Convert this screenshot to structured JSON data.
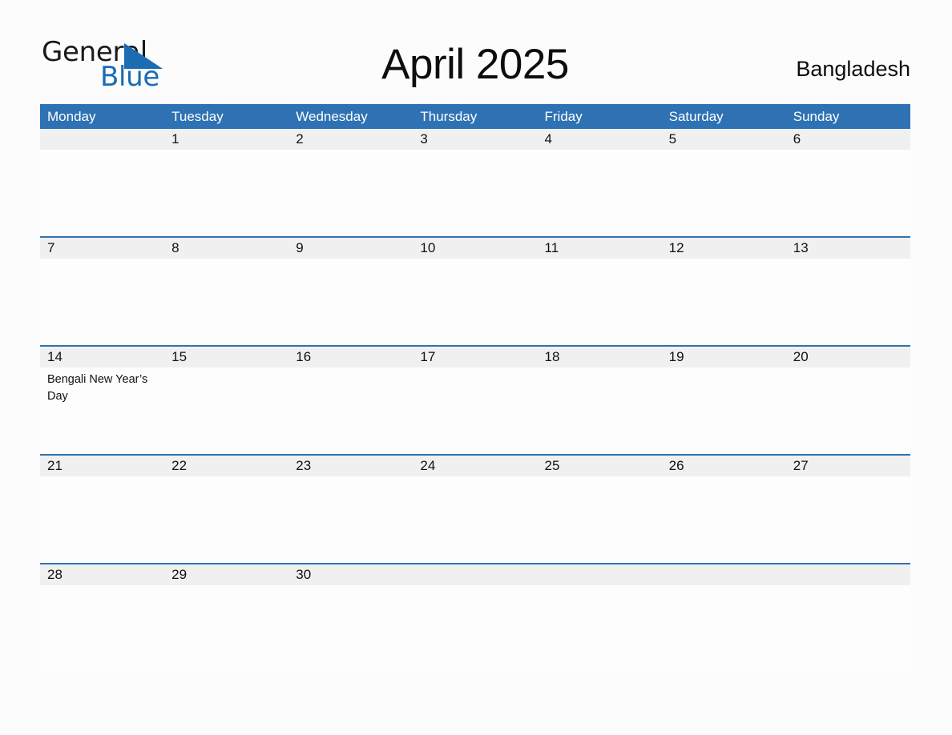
{
  "brand": {
    "name_part1": "General",
    "name_part2": "Blue",
    "colors": {
      "primary_blue": "#2e72b4",
      "logo_blue": "#1b6cb3",
      "strip_gray": "#f0f0f0",
      "page_background": "#fcfcfc"
    }
  },
  "header": {
    "title": "April 2025",
    "country": "Bangladesh"
  },
  "calendar": {
    "weekdays": [
      "Monday",
      "Tuesday",
      "Wednesday",
      "Thursday",
      "Friday",
      "Saturday",
      "Sunday"
    ],
    "weeks": [
      {
        "days": [
          {
            "num": "",
            "events": []
          },
          {
            "num": "1",
            "events": []
          },
          {
            "num": "2",
            "events": []
          },
          {
            "num": "3",
            "events": []
          },
          {
            "num": "4",
            "events": []
          },
          {
            "num": "5",
            "events": []
          },
          {
            "num": "6",
            "events": []
          }
        ]
      },
      {
        "days": [
          {
            "num": "7",
            "events": []
          },
          {
            "num": "8",
            "events": []
          },
          {
            "num": "9",
            "events": []
          },
          {
            "num": "10",
            "events": []
          },
          {
            "num": "11",
            "events": []
          },
          {
            "num": "12",
            "events": []
          },
          {
            "num": "13",
            "events": []
          }
        ]
      },
      {
        "days": [
          {
            "num": "14",
            "events": [
              "Bengali New Year’s Day"
            ]
          },
          {
            "num": "15",
            "events": []
          },
          {
            "num": "16",
            "events": []
          },
          {
            "num": "17",
            "events": []
          },
          {
            "num": "18",
            "events": []
          },
          {
            "num": "19",
            "events": []
          },
          {
            "num": "20",
            "events": []
          }
        ]
      },
      {
        "days": [
          {
            "num": "21",
            "events": []
          },
          {
            "num": "22",
            "events": []
          },
          {
            "num": "23",
            "events": []
          },
          {
            "num": "24",
            "events": []
          },
          {
            "num": "25",
            "events": []
          },
          {
            "num": "26",
            "events": []
          },
          {
            "num": "27",
            "events": []
          }
        ]
      },
      {
        "days": [
          {
            "num": "28",
            "events": []
          },
          {
            "num": "29",
            "events": []
          },
          {
            "num": "30",
            "events": []
          },
          {
            "num": "",
            "events": []
          },
          {
            "num": "",
            "events": []
          },
          {
            "num": "",
            "events": []
          },
          {
            "num": "",
            "events": []
          }
        ]
      }
    ]
  }
}
